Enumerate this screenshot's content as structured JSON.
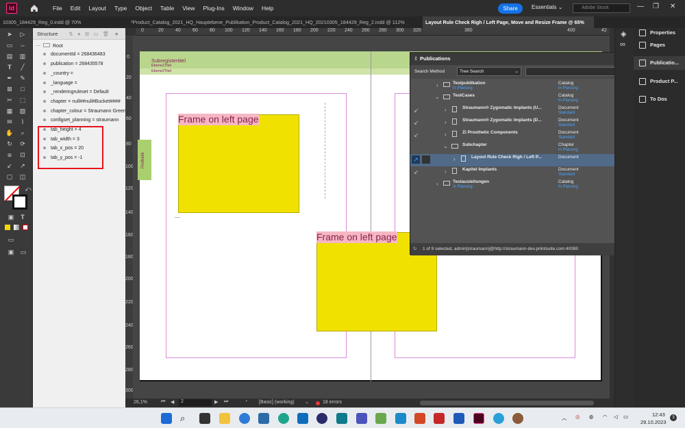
{
  "app": {
    "logo": "Id"
  },
  "menu": [
    "File",
    "Edit",
    "Layout",
    "Type",
    "Object",
    "Table",
    "View",
    "Plug-Ins",
    "Window",
    "Help"
  ],
  "header": {
    "share": "Share",
    "workspace": "Essentials",
    "stock_placeholder": "Adobe Stock"
  },
  "tabs": [
    {
      "label": "10305_184429_Reg_0.indd @ 70%"
    },
    {
      "label": "*Product_Catalog_2021_HQ_Hauptebene_Publikation_Product_Catalog_2021_HQ_20210305_184429_Reg_2.indd @ 112%"
    },
    {
      "label": "Layout Rule Check Righ / Left Page, Move and Resize Frame @ 65%"
    }
  ],
  "structure": {
    "title": "Structure",
    "root": "Root",
    "items": [
      "documentId = 268436483",
      "publication = 268435578",
      "_country =",
      "_language =",
      "_renderingruleset = Default",
      "chapter = null##null#Bucket####",
      "chapter_colour = Straumann Green",
      "configset_planning = straumann",
      "tab_height = 4",
      "tab_width = 3",
      "tab_x_pos = 20",
      "tab_y_pos = -1"
    ]
  },
  "ruler": {
    "top": [
      "0",
      "20",
      "40",
      "60",
      "80",
      "100",
      "120",
      "140",
      "160",
      "180",
      "200",
      "220",
      "240",
      "260",
      "280",
      "300",
      "320",
      "340",
      "360",
      "380",
      "400",
      "42"
    ],
    "left": [
      "0",
      "20",
      "40",
      "60",
      "80",
      "100",
      "120",
      "140",
      "160",
      "180",
      "200",
      "220",
      "240",
      "260",
      "280",
      "300"
    ]
  },
  "page": {
    "subregister": "Subregistertitel",
    "level1": "Ebene1Titel",
    "level2": "Ebene2Titel",
    "side_tab": "Prothetik",
    "frame1": "Frame on left page",
    "frame2": "Frame on left page"
  },
  "publications": {
    "title": "Publications",
    "search_label": "Search Method",
    "search_method": "Tree Search",
    "rows": [
      {
        "name": "Testpublikation",
        "sub": "In Planung",
        "type": "Catalog",
        "type_sub": "In Planung"
      },
      {
        "name": "TestCases",
        "sub": "",
        "type": "Catalog",
        "type_sub": "In Planung"
      },
      {
        "name": "Straumann® Zygomatic Implants (U...",
        "sub": "",
        "type": "Document",
        "type_sub": "Standard"
      },
      {
        "name": "Straumann® Zygomatic Implants (D...",
        "sub": "",
        "type": "Document",
        "type_sub": "Standard"
      },
      {
        "name": "Zi Prosthetic Components",
        "sub": "",
        "type": "Document",
        "type_sub": "Standard"
      },
      {
        "name": "Subchapter",
        "sub": "",
        "type": "Chapter",
        "type_sub": "In Planung"
      },
      {
        "name": "Layout Rule Check Righ / Left P...",
        "sub": "",
        "type": "Document",
        "type_sub": ""
      },
      {
        "name": "Kapitel Implants",
        "sub": "",
        "type": "Document",
        "type_sub": "Standard"
      },
      {
        "name": "Testausleitungen",
        "sub": "In Planung",
        "type": "Catalog",
        "type_sub": "In Planung"
      }
    ],
    "status": "1 of 9 selected, admin[straumann]@http://straumann-dev.priintsuite.com:40080",
    "help": "?"
  },
  "dock": {
    "properties": "Properties",
    "pages": "Pages",
    "publications": "Publicatio...",
    "product": "Product P...",
    "todos": "To Dos"
  },
  "statusbar": {
    "zoom": "26,1%",
    "page": "2",
    "style": "[Basic] (working)",
    "errors": "18 errors"
  },
  "taskbar": {
    "time": "12:43",
    "date": "29.10.2023",
    "badge": "3"
  }
}
